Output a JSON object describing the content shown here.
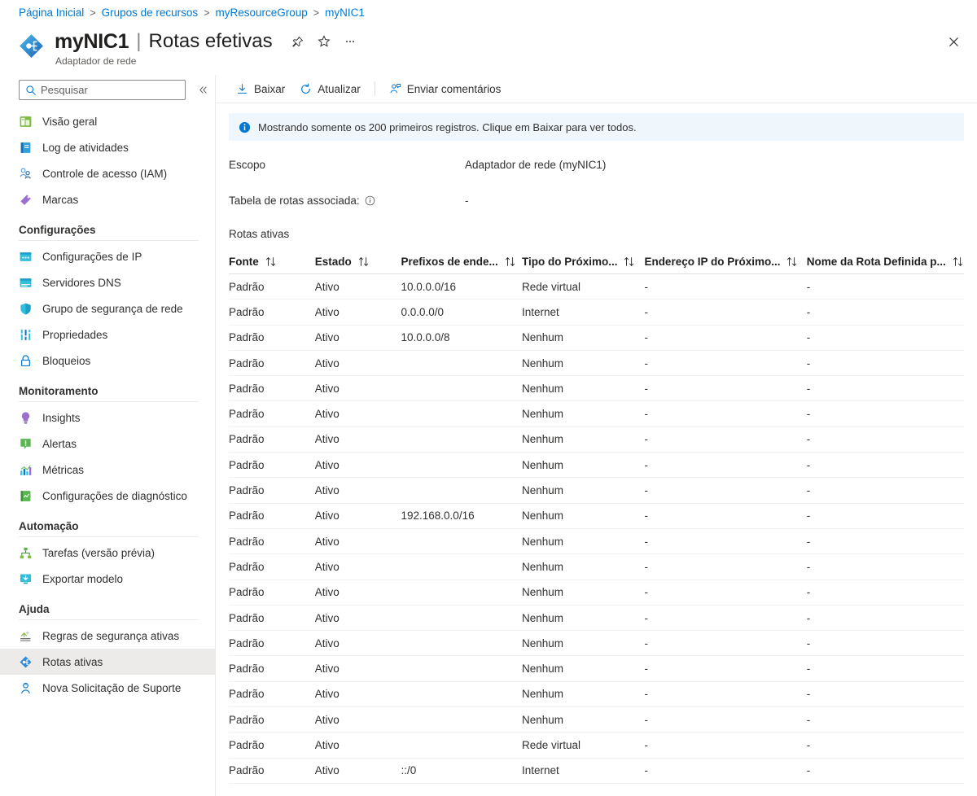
{
  "breadcrumb": {
    "items": [
      {
        "label": "Página Inicial"
      },
      {
        "label": "Grupos de recursos"
      },
      {
        "label": "myResourceGroup"
      },
      {
        "label": "myNIC1"
      }
    ],
    "separator": ">"
  },
  "header": {
    "resource_name": "myNIC1",
    "pipe": "|",
    "page_title": "Rotas efetivas",
    "subtitle": "Adaptador de rede",
    "pin_icon": "pin-icon",
    "favorite_icon": "star-icon",
    "more_icon": "ellipsis-icon",
    "close_icon": "close-icon",
    "resource_icon": "network-interface-icon"
  },
  "search": {
    "placeholder": "Pesquisar",
    "value": "",
    "icon": "search-icon",
    "collapse_icon": "chevron-double-left-icon"
  },
  "sidebar": {
    "items": [
      {
        "label": "Visão geral",
        "icon": "overview-icon",
        "selected": false
      },
      {
        "label": "Log de atividades",
        "icon": "activity-log-icon",
        "selected": false
      },
      {
        "label": "Controle de acesso (IAM)",
        "icon": "access-control-icon",
        "selected": false
      },
      {
        "label": "Marcas",
        "icon": "tags-icon",
        "selected": false
      }
    ],
    "groups": [
      {
        "title": "Configurações",
        "items": [
          {
            "label": "Configurações de IP",
            "icon": "ip-configurations-icon",
            "selected": false
          },
          {
            "label": "Servidores DNS",
            "icon": "dns-servers-icon",
            "selected": false
          },
          {
            "label": "Grupo de segurança de rede",
            "icon": "network-security-group-icon",
            "selected": false
          },
          {
            "label": "Propriedades",
            "icon": "properties-icon",
            "selected": false
          },
          {
            "label": "Bloqueios",
            "icon": "locks-icon",
            "selected": false
          }
        ]
      },
      {
        "title": "Monitoramento",
        "items": [
          {
            "label": "Insights",
            "icon": "insights-icon",
            "selected": false
          },
          {
            "label": "Alertas",
            "icon": "alerts-icon",
            "selected": false
          },
          {
            "label": "Métricas",
            "icon": "metrics-icon",
            "selected": false
          },
          {
            "label": "Configurações de diagnóstico",
            "icon": "diagnostic-settings-icon",
            "selected": false
          }
        ]
      },
      {
        "title": "Automação",
        "items": [
          {
            "label": "Tarefas (versão prévia)",
            "icon": "tasks-icon",
            "selected": false
          },
          {
            "label": "Exportar modelo",
            "icon": "export-template-icon",
            "selected": false
          }
        ]
      },
      {
        "title": "Ajuda",
        "items": [
          {
            "label": "Regras de segurança ativas",
            "icon": "effective-security-rules-icon",
            "selected": false
          },
          {
            "label": "Rotas ativas",
            "icon": "effective-routes-icon",
            "selected": true
          },
          {
            "label": "Nova Solicitação de Suporte",
            "icon": "support-request-icon",
            "selected": false
          }
        ]
      }
    ]
  },
  "toolbar": {
    "download_label": "Baixar",
    "download_icon": "download-icon",
    "refresh_label": "Atualizar",
    "refresh_icon": "refresh-icon",
    "feedback_label": "Enviar comentários",
    "feedback_icon": "feedback-icon"
  },
  "banner": {
    "icon": "info-icon",
    "text": "Mostrando somente os 200 primeiros registros. Clique em Baixar para ver todos."
  },
  "details": {
    "scope_label": "Escopo",
    "scope_value": "Adaptador de rede (myNIC1)",
    "route_table_label": "Tabela de rotas associada:",
    "route_table_info_icon": "info-circle-icon",
    "route_table_value": "-"
  },
  "table": {
    "section_title": "Rotas ativas",
    "sort_icon": "sort-ascending-descending-icon",
    "columns": [
      {
        "label": "Fonte",
        "sortable": true
      },
      {
        "label": "Estado",
        "sortable": true
      },
      {
        "label": "Prefixos de ende...",
        "sortable": true
      },
      {
        "label": "Tipo do Próximo...",
        "sortable": true
      },
      {
        "label": "Endereço IP do Próximo...",
        "sortable": true
      },
      {
        "label": "Nome da Rota Definida p...",
        "sortable": true
      }
    ],
    "rows": [
      [
        "Padrão",
        "Ativo",
        "10.0.0.0/16",
        "Rede virtual",
        "-",
        "-"
      ],
      [
        "Padrão",
        "Ativo",
        "0.0.0.0/0",
        "Internet",
        "-",
        "-"
      ],
      [
        "Padrão",
        "Ativo",
        "10.0.0.0/8",
        "Nenhum",
        "-",
        "-"
      ],
      [
        "Padrão",
        "Ativo",
        "",
        "Nenhum",
        "-",
        "-"
      ],
      [
        "Padrão",
        "Ativo",
        "",
        "Nenhum",
        "-",
        "-"
      ],
      [
        "Padrão",
        "Ativo",
        "",
        "Nenhum",
        "-",
        "-"
      ],
      [
        "Padrão",
        "Ativo",
        "",
        "Nenhum",
        "-",
        "-"
      ],
      [
        "Padrão",
        "Ativo",
        "",
        "Nenhum",
        "-",
        "-"
      ],
      [
        "Padrão",
        "Ativo",
        "",
        "Nenhum",
        "-",
        "-"
      ],
      [
        "Padrão",
        "Ativo",
        "192.168.0.0/16",
        "Nenhum",
        "-",
        "-"
      ],
      [
        "Padrão",
        "Ativo",
        "",
        "Nenhum",
        "-",
        "-"
      ],
      [
        "Padrão",
        "Ativo",
        "",
        "Nenhum",
        "-",
        "-"
      ],
      [
        "Padrão",
        "Ativo",
        "",
        "Nenhum",
        "-",
        "-"
      ],
      [
        "Padrão",
        "Ativo",
        "",
        "Nenhum",
        "-",
        "-"
      ],
      [
        "Padrão",
        "Ativo",
        "",
        "Nenhum",
        "-",
        "-"
      ],
      [
        "Padrão",
        "Ativo",
        "",
        "Nenhum",
        "-",
        "-"
      ],
      [
        "Padrão",
        "Ativo",
        "",
        "Nenhum",
        "-",
        "-"
      ],
      [
        "Padrão",
        "Ativo",
        "",
        "Nenhum",
        "-",
        "-"
      ],
      [
        "Padrão",
        "Ativo",
        "",
        "Rede virtual",
        "-",
        "-"
      ],
      [
        "Padrão",
        "Ativo",
        "::/0",
        "Internet",
        "-",
        "-"
      ]
    ]
  },
  "colors": {
    "accent": "#0078d4",
    "banner_bg": "#eff6fc",
    "selected_bg": "#edebe9",
    "text": "#323130",
    "border": "#e1dfdd"
  }
}
